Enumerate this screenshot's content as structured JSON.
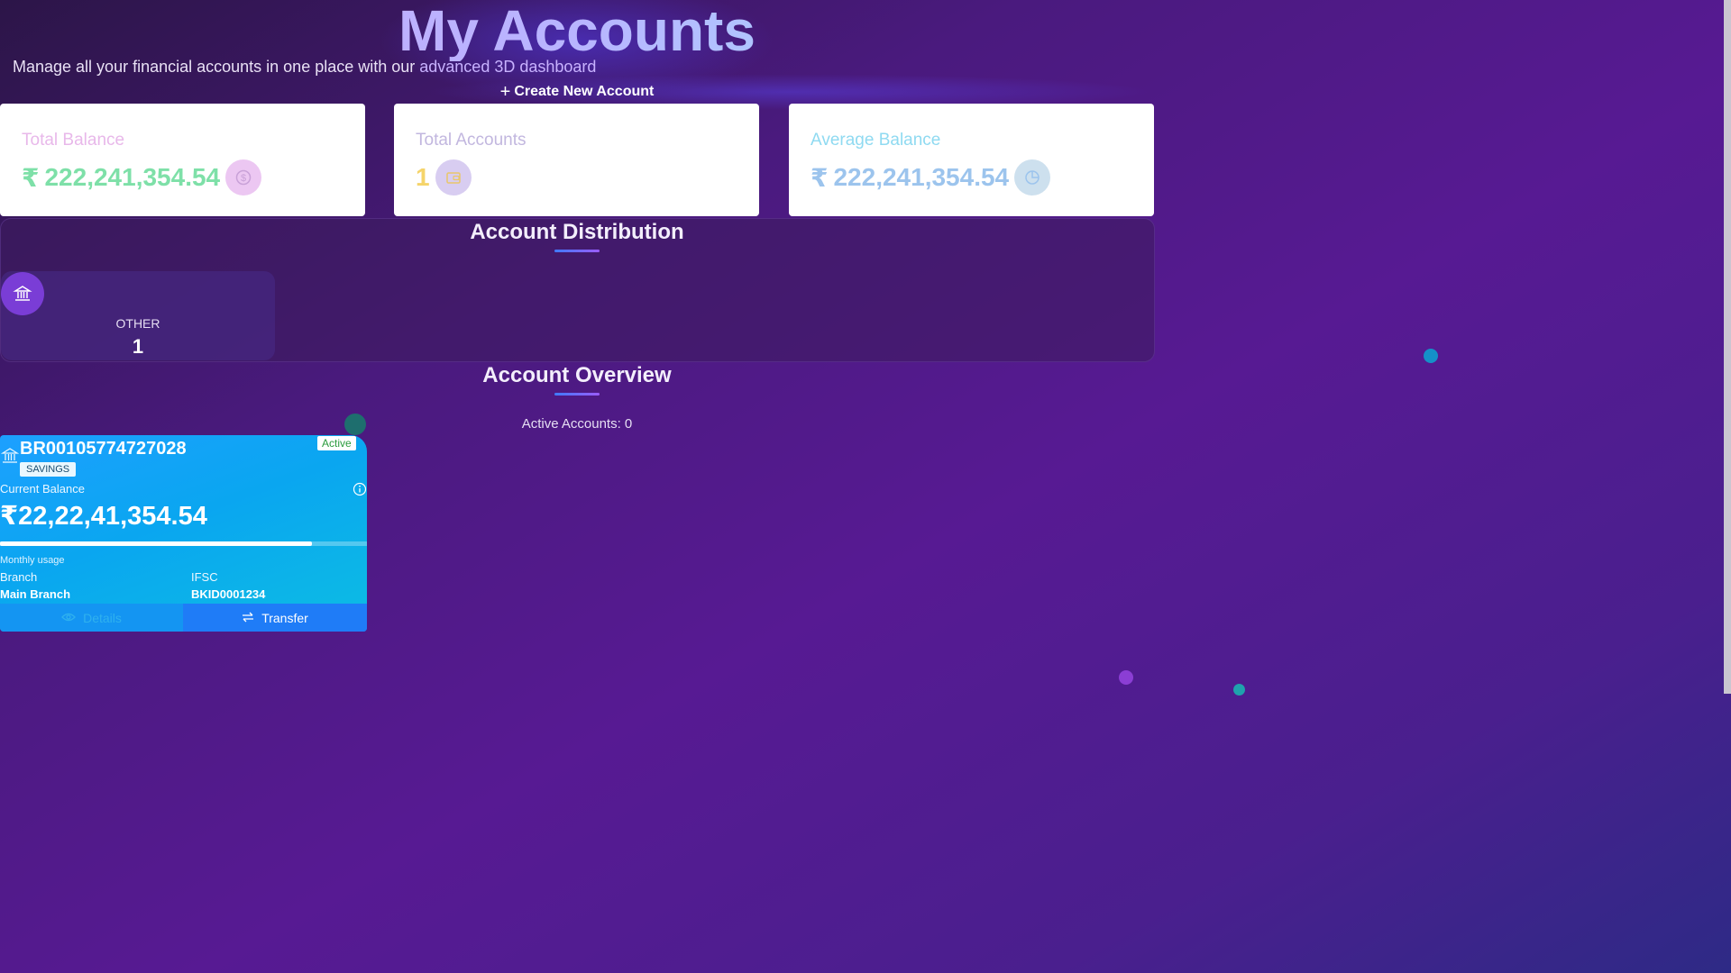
{
  "header": {
    "title": "My Accounts",
    "subtitle_prefix": "Manage all your financial accounts in one place with our ",
    "subtitle_highlight": "advanced 3D dashboard",
    "create_button": "Create New Account"
  },
  "stats": [
    {
      "label": "Total Balance",
      "currency": "₹",
      "value": "222,241,354.54",
      "icon": "dollar-icon"
    },
    {
      "label": "Total Accounts",
      "currency": "",
      "value": "1",
      "icon": "wallet-icon"
    },
    {
      "label": "Average Balance",
      "currency": "₹",
      "value": "222,241,354.54",
      "icon": "pie-chart-icon"
    }
  ],
  "distribution": {
    "title": "Account Distribution",
    "items": [
      {
        "label": "OTHER",
        "count": "1",
        "icon": "bank-icon"
      }
    ]
  },
  "overview": {
    "title": "Account Overview",
    "active_accounts": "Active Accounts: 0"
  },
  "account": {
    "number": "BR00105774727028",
    "type": "SAVINGS",
    "status": "Active",
    "balance_label": "Current Balance",
    "balance": "₹22,22,41,354.54",
    "usage_label": "Monthly usage",
    "usage_fraction": 0.85,
    "branch_label": "Branch",
    "branch_value": "Main Branch",
    "ifsc_label": "IFSC",
    "ifsc_value": "BKID0001234",
    "details_button": "Details",
    "transfer_button": "Transfer"
  },
  "colors": {
    "accent": "#7a3dd6",
    "card_gradient_start": "#1da0ff",
    "card_gradient_end": "#0dbde3",
    "status_active": "#2a9b3d"
  }
}
